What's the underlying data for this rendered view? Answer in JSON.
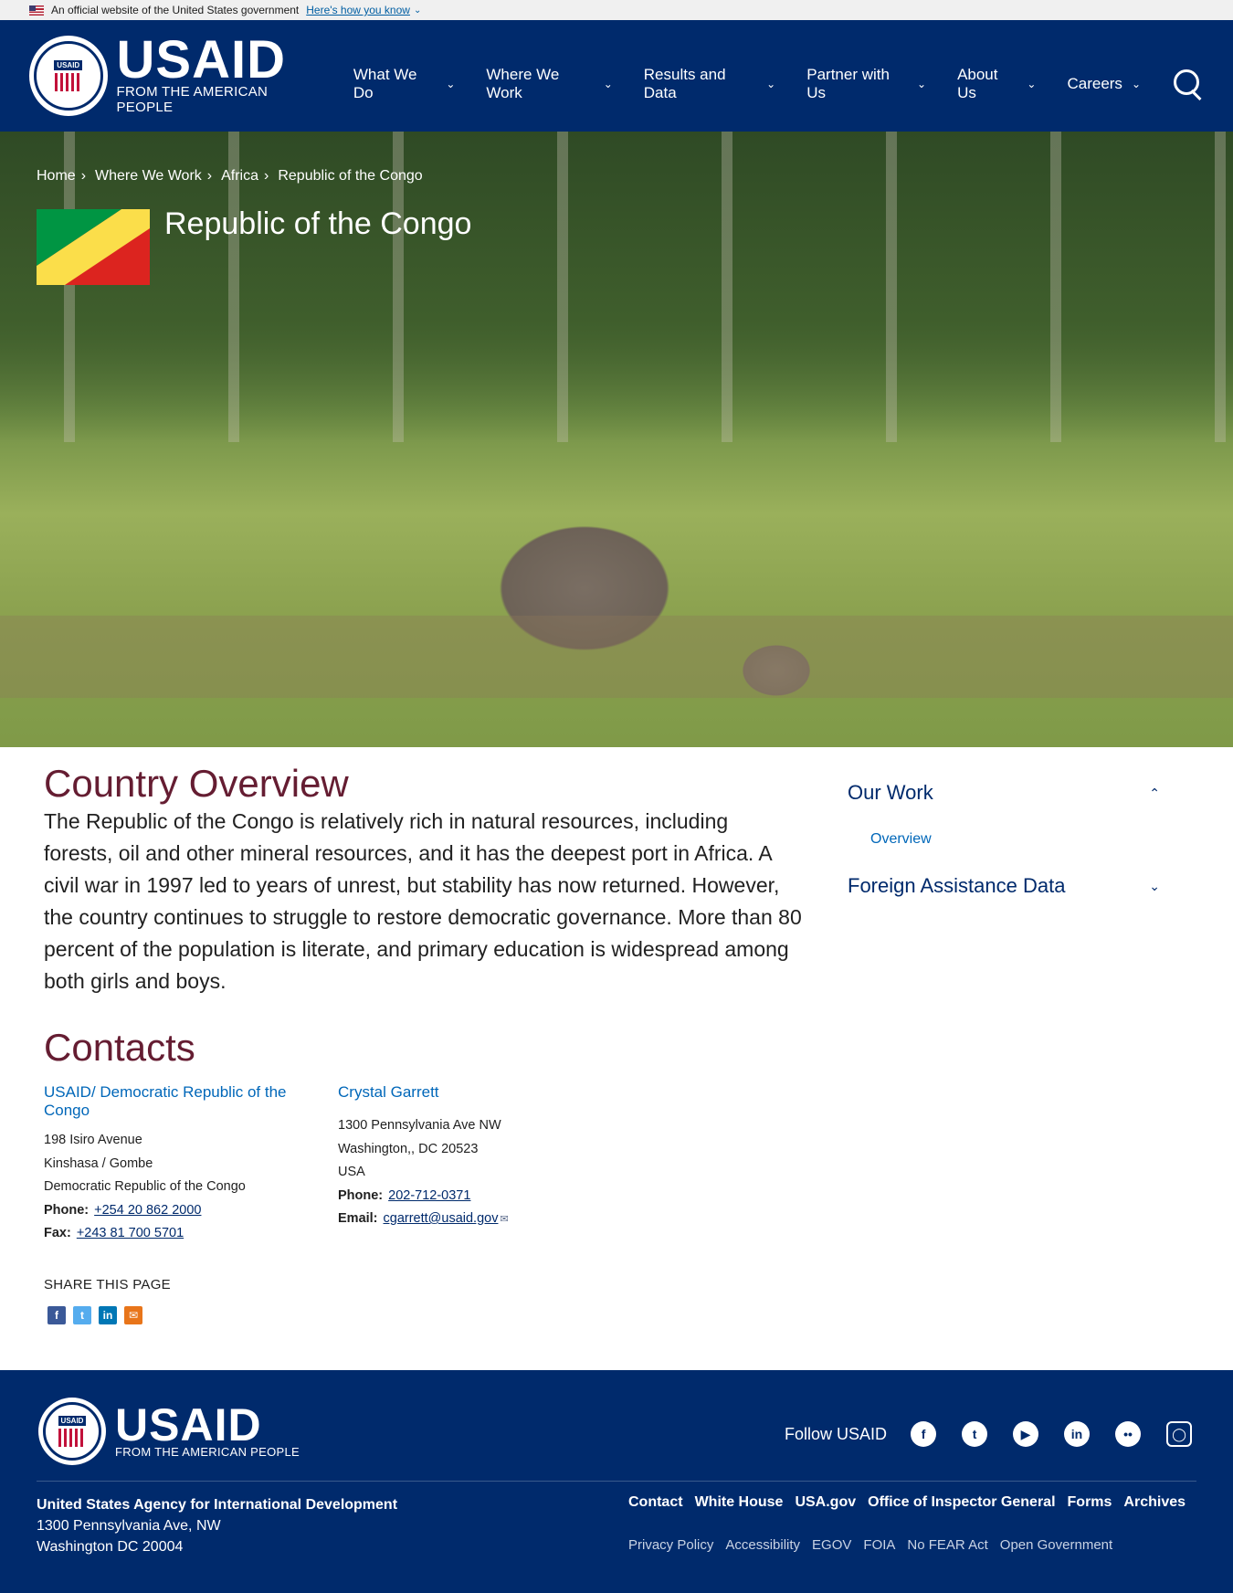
{
  "gov_banner": {
    "text": "An official website of the United States government",
    "link": "Here's how you know"
  },
  "header": {
    "logo_text": "USAID",
    "logo_sub": "FROM THE AMERICAN PEOPLE",
    "seal_text": "USAID",
    "nav": [
      {
        "label": "What We Do"
      },
      {
        "label": "Where We Work"
      },
      {
        "label": "Results and Data"
      },
      {
        "label": "Partner with Us"
      },
      {
        "label": "About Us"
      },
      {
        "label": "Careers"
      }
    ]
  },
  "hero": {
    "breadcrumb": [
      "Home",
      "Where We Work",
      "Africa",
      "Republic of the Congo"
    ],
    "title": "Republic of the Congo",
    "flag_colors": {
      "green": "#009543",
      "yellow": "#fbde4a",
      "red": "#dc241f"
    }
  },
  "overview": {
    "title": "Country Overview",
    "text": "The Republic of the Congo is relatively rich in natural resources, including forests, oil and other mineral resources, and it has the deepest port in Africa. A civil war in 1997 led to years of unrest, but stability has now returned. However, the country continues to struggle to restore democratic governance. More than 80 percent of the population is literate, and primary education is widespread among both girls and boys."
  },
  "contacts": {
    "title": "Contacts",
    "items": [
      {
        "name": "USAID/ Democratic Republic of the Congo",
        "address": [
          "198 Isiro Avenue",
          "Kinshasa / Gombe",
          "Democratic Republic of the Congo"
        ],
        "phone_label": "Phone:",
        "phone": "+254 20 862 2000",
        "fax_label": "Fax:",
        "fax": "+243 81 700 5701"
      },
      {
        "name": "Crystal Garrett",
        "address": [
          "1300 Pennsylvania Ave NW",
          "Washington,, DC 20523",
          "USA"
        ],
        "phone_label": "Phone:",
        "phone": "202-712-0371",
        "email_label": "Email:",
        "email": "cgarrett@usaid.gov"
      }
    ]
  },
  "share": {
    "label": "SHARE THIS PAGE",
    "icons": [
      "facebook-icon",
      "twitter-icon",
      "linkedin-icon",
      "email-icon"
    ]
  },
  "sidebar": {
    "our_work": "Our Work",
    "overview_link": "Overview",
    "foreign_assistance": "Foreign Assistance Data"
  },
  "footer": {
    "follow_label": "Follow USAID",
    "social_icons": [
      "facebook-icon",
      "twitter-icon",
      "youtube-icon",
      "linkedin-icon",
      "flickr-icon",
      "instagram-icon"
    ],
    "agency_name": "United States Agency for International Development",
    "address_1": "1300 Pennsylvania Ave, NW",
    "address_2": "Washington DC 20004",
    "links_primary": [
      "Contact",
      "White House",
      "USA.gov",
      "Office of Inspector General",
      "Forms",
      "Archives"
    ],
    "links_secondary": [
      "Privacy Policy",
      "Accessibility",
      "EGOV",
      "FOIA",
      "No FEAR Act",
      "Open Government"
    ]
  },
  "colors": {
    "navy": "#002a6c",
    "heading_maroon": "#651d32",
    "link_blue": "#0067b9"
  }
}
